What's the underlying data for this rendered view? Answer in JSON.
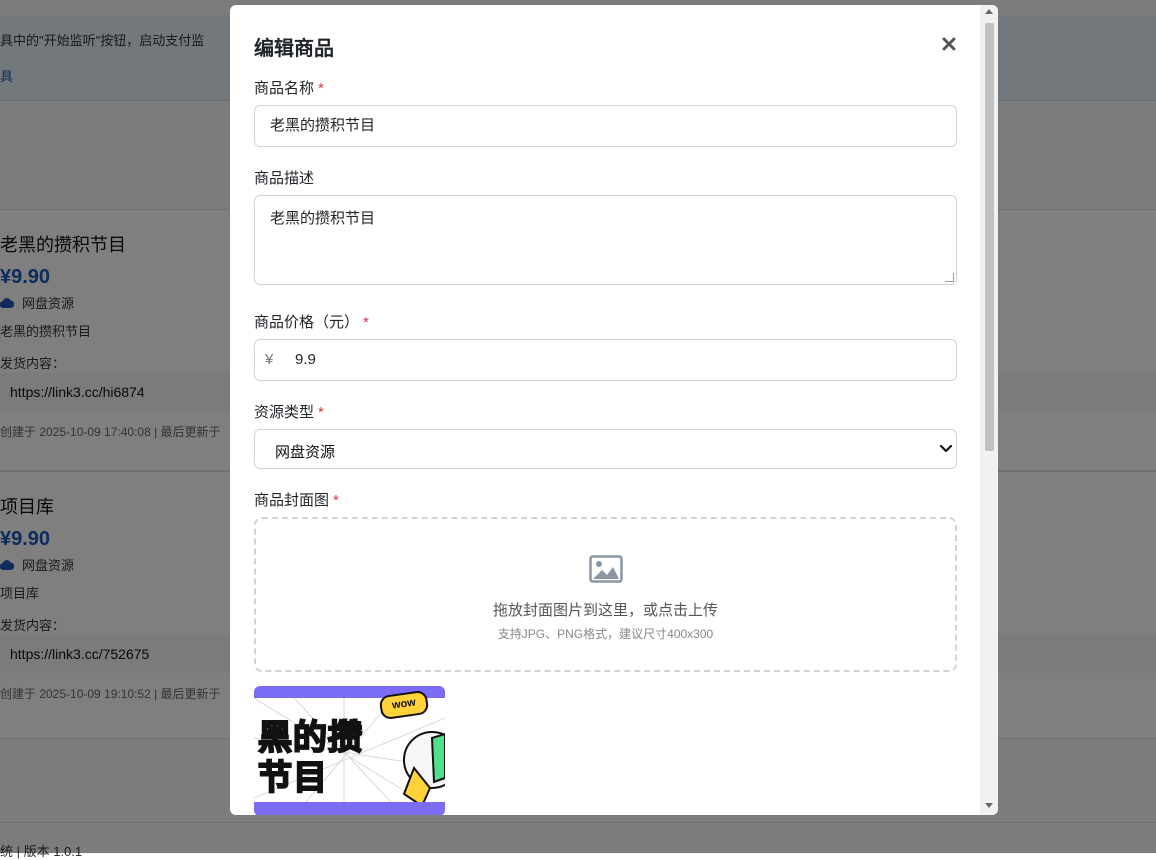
{
  "background": {
    "alert_text": "具中的\"开始监听\"按钮，启动支付监",
    "alert_link": "具",
    "products": [
      {
        "title": "老黑的攒积节目",
        "price": "¥9.90",
        "type": "网盘资源",
        "desc": "老黑的攒积节目",
        "delivery_label": "发货内容：",
        "link": "https://link3.cc/hi6874",
        "meta": "创建于 2025-10-09 17:40:08 | 最后更新于"
      },
      {
        "title": "项目库",
        "price": "¥9.90",
        "type": "网盘资源",
        "desc": "项目库",
        "delivery_label": "发货内容：",
        "link": "https://link3.cc/752675",
        "meta": "创建于 2025-10-09 19:10:52 | 最后更新于"
      }
    ],
    "footer": "统 | 版本 1.0.1"
  },
  "modal": {
    "title": "编辑商品",
    "close_icon": "close-icon",
    "name_label": "商品名称",
    "name_value": "老黑的攒积节目",
    "desc_label": "商品描述",
    "desc_value": "老黑的攒积节目",
    "price_label": "商品价格（元）",
    "price_symbol": "¥",
    "price_value": "9.9",
    "type_label": "资源类型",
    "type_value": "网盘资源",
    "cover_label": "商品封面图",
    "required_mark": "*",
    "upload_icon": "image-icon",
    "upload_text": "拖放封面图片到这里，或点击上传",
    "upload_hint": "支持JPG、PNG格式，建议尺寸400x300",
    "preview_line1": "黑的攒",
    "preview_line2": "节目",
    "preview_badge": "wow"
  },
  "colors": {
    "accent": "#1a56b8",
    "required": "#dc3545",
    "preview_green": "#4ee08a",
    "preview_purple": "#7b6cf5"
  }
}
